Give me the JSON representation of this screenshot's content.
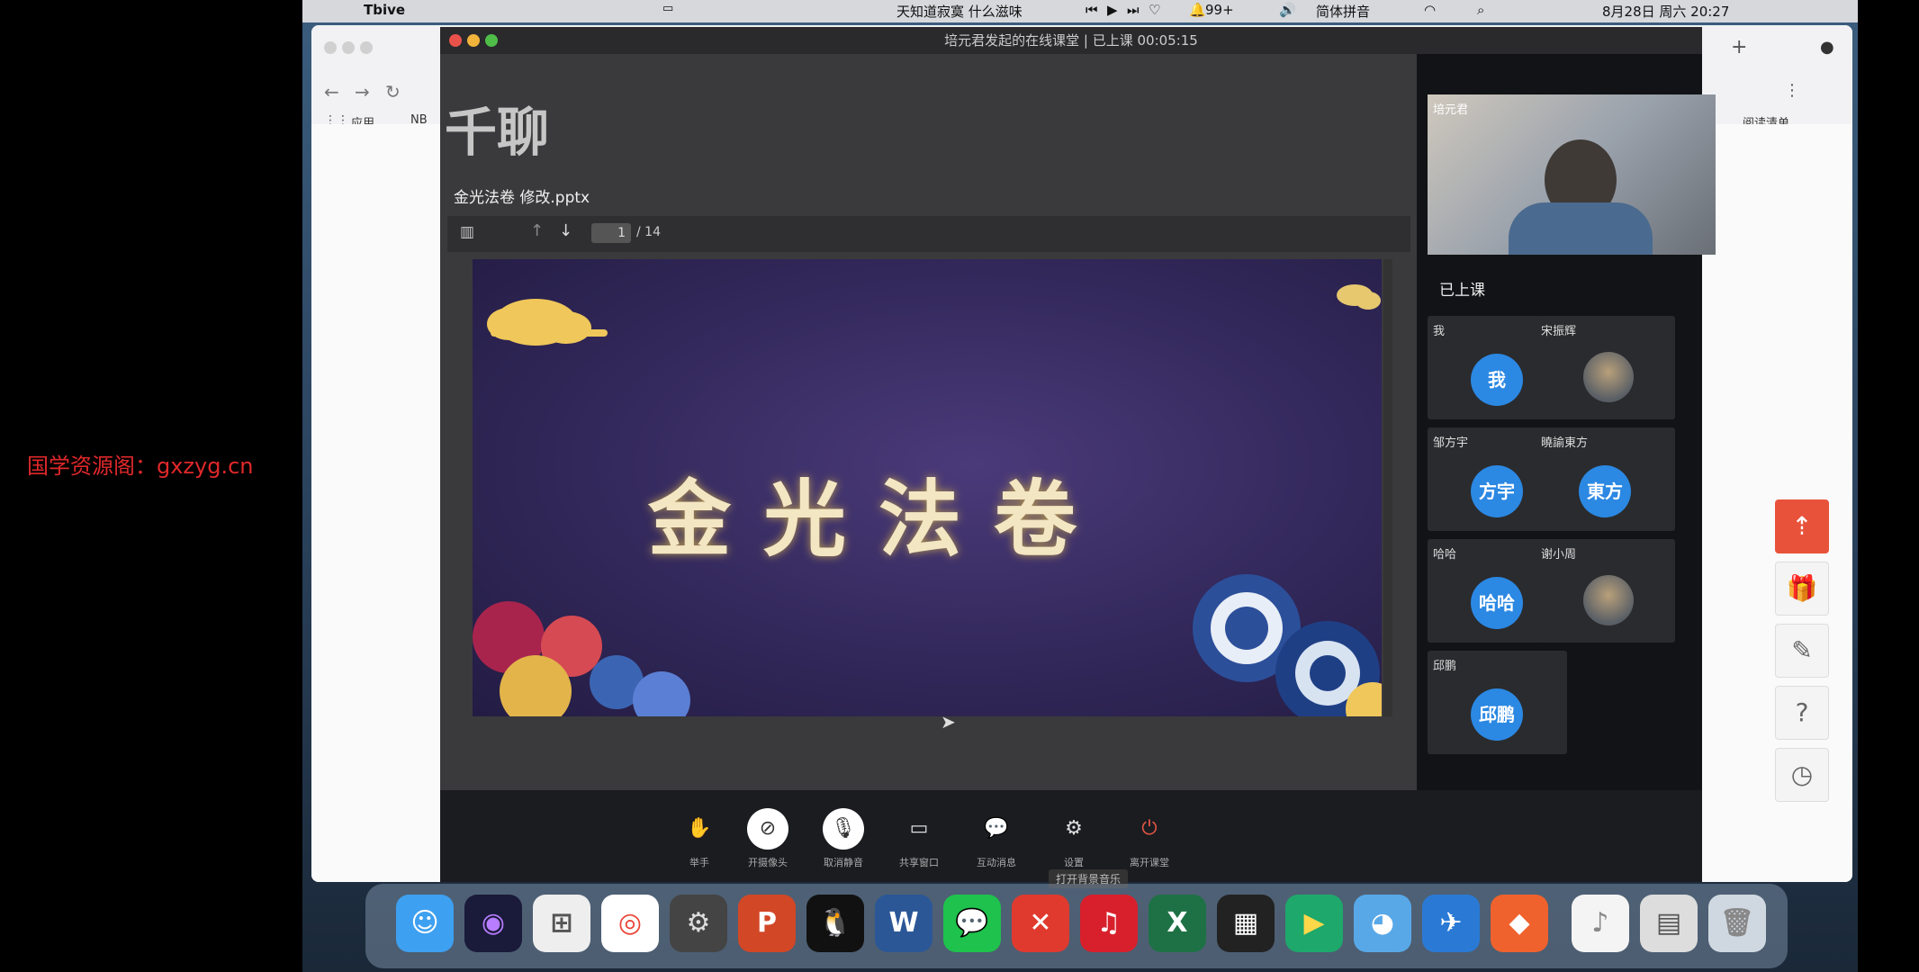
{
  "watermark": "国学资源阁：gxzyg.cn",
  "menubar": {
    "app_name": "Tbive",
    "now_playing": "天知道寂寞 什么滋味",
    "notification_count": "99+",
    "input_method": "简体拼音",
    "datetime": "8月28日 周六 20:27"
  },
  "browser": {
    "bookmark_apps": "应用",
    "bookmark_nb": "NB",
    "reading_list": "阅读清单"
  },
  "conference": {
    "title": "培元君发起的在线课堂 | 已上课 00:05:15",
    "logo_text": "千聊",
    "file_name": "金光法卷 修改.pptx",
    "current_page": "1",
    "total_pages": "/ 14",
    "slide_title": "金光法卷",
    "teacher_name": "培元君",
    "status_label": "已上课",
    "participants": [
      {
        "name": "我",
        "avatar": "我",
        "type": "initial"
      },
      {
        "name": "宋振辉",
        "avatar": "",
        "type": "photo"
      },
      {
        "name": "邹方宇",
        "avatar": "方宇",
        "type": "initial"
      },
      {
        "name": "曉諭東方",
        "avatar": "東方",
        "type": "initial"
      },
      {
        "name": "哈哈",
        "avatar": "哈哈",
        "type": "initial"
      },
      {
        "name": "谢小周",
        "avatar": "",
        "type": "photo"
      },
      {
        "name": "邱鹏",
        "avatar": "邱鹏",
        "type": "initial"
      }
    ],
    "controls": [
      {
        "icon": "hand-icon",
        "glyph": "✋",
        "label": "举手"
      },
      {
        "icon": "camera-off-icon",
        "glyph": "⊘",
        "label": "开摄像头"
      },
      {
        "icon": "mic-off-icon",
        "glyph": "🎙",
        "label": "取消静音"
      },
      {
        "icon": "share-window-icon",
        "glyph": "▭",
        "label": "共享窗口"
      },
      {
        "icon": "chat-icon",
        "glyph": "💬",
        "label": "互动消息"
      },
      {
        "icon": "settings-icon",
        "glyph": "⚙",
        "label": "设置"
      },
      {
        "icon": "leave-icon",
        "glyph": "⏻",
        "label": "离开课堂"
      }
    ],
    "tooltip": "打开背景音乐"
  },
  "colors": {
    "avatar_blue": "#2b88e3",
    "leave_red": "#e25543",
    "top_btn": "#e8523a"
  }
}
